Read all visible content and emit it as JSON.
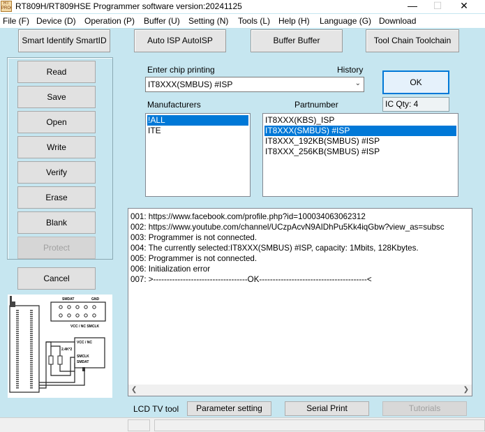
{
  "window": {
    "title": "RT809H/RT809HSE Programmer software version:20241125",
    "icon_text": "RT PROG",
    "minimize": "—",
    "maximize": "☐",
    "close": "✕"
  },
  "menu": [
    "File (F)",
    "Device (D)",
    "Operation (P)",
    "Buffer (U)",
    "Setting (N)",
    "Tools (L)",
    "Help (H)",
    "Language (G)",
    "Download"
  ],
  "toolbar": {
    "smart_identify": "Smart Identify SmartID",
    "auto_isp": "Auto ISP AutoISP",
    "buffer": "Buffer Buffer",
    "tool_chain": "Tool Chain Toolchain"
  },
  "side_buttons": {
    "read": "Read",
    "save": "Save",
    "open": "Open",
    "write": "Write",
    "verify": "Verify",
    "erase": "Erase",
    "blank": "Blank",
    "protect": "Protect",
    "cancel": "Cancel"
  },
  "diagram": {
    "smdat": "SMDAT",
    "gnd": "GND",
    "vcc_smclk": "VCC / NC   SMCLK",
    "vcc_nc": "VCC / NC",
    "resistor": "2.4K*2",
    "smclk": "SMCLK",
    "smdat2": "SMDAT"
  },
  "chip": {
    "enter_label": "Enter chip printing",
    "history_label": "History",
    "value": "IT8XXX(SMBUS) #ISP",
    "ok": "OK",
    "ic_qty": "IC Qty: 4",
    "manufacturers_label": "Manufacturers",
    "partnumber_label": "Partnumber",
    "manufacturers": [
      "!ALL",
      "ITE"
    ],
    "partnumbers": [
      "IT8XXX(KBS)_ISP",
      "IT8XXX(SMBUS) #ISP",
      "IT8XXX_192KB(SMBUS) #ISP",
      "IT8XXX_256KB(SMBUS) #ISP"
    ]
  },
  "log": [
    "001:  https://www.facebook.com/profile.php?id=100034063062312",
    "002:  https://www.youtube.com/channel/UCzpAcvN9AIDhPu5Kk4iqGbw?view_as=subsc",
    "003:  Programmer is not connected.",
    "004:  The currently selected:IT8XXX(SMBUS) #ISP, capacity: 1Mbits, 128Kbytes.",
    "005:  Programmer is not connected.",
    "006:  Initialization error",
    "007:  >-----------------------------------OK----------------------------------------<"
  ],
  "bottom": {
    "lcd_tv_tool": "LCD TV tool",
    "parameter_setting": "Parameter setting",
    "serial_print": "Serial Print",
    "tutorials": "Tutorials"
  },
  "colors": {
    "background": "#c6e6f0",
    "selection": "#0078d7"
  }
}
